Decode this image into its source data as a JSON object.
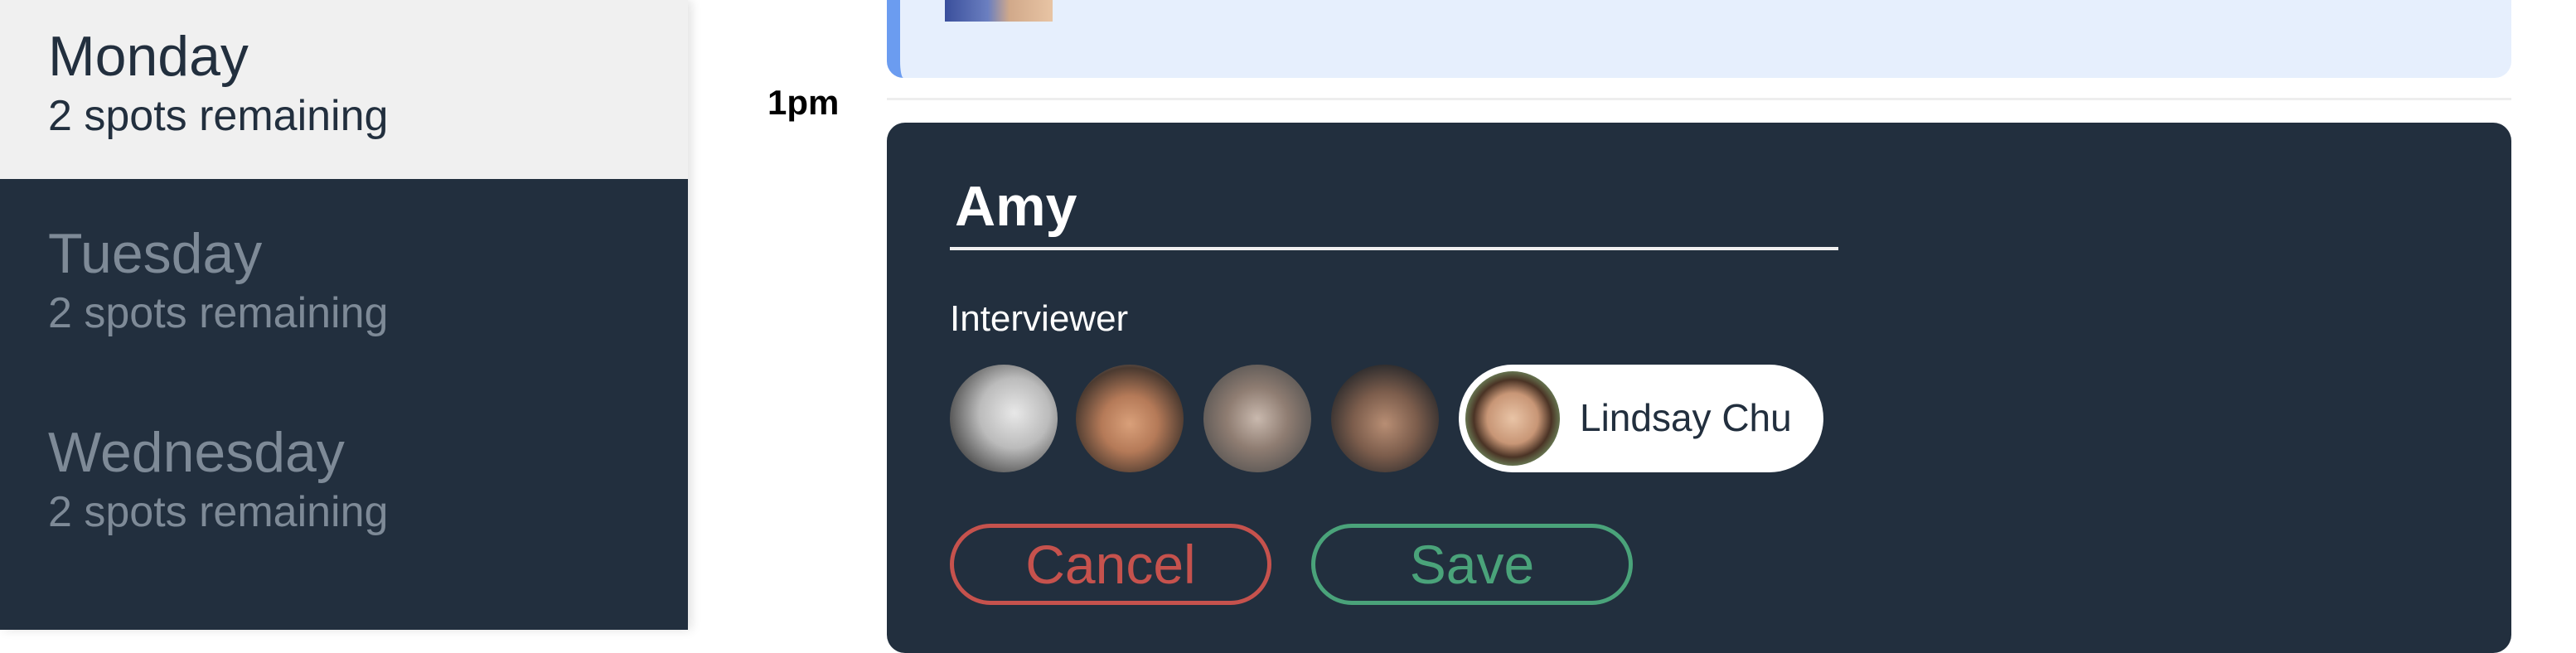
{
  "sidebar": {
    "days": [
      {
        "name": "Monday",
        "spots": "2 spots remaining",
        "selected": true
      },
      {
        "name": "Tuesday",
        "spots": "2 spots remaining",
        "selected": false
      },
      {
        "name": "Wednesday",
        "spots": "2 spots remaining",
        "selected": false
      }
    ]
  },
  "schedule": {
    "time_label": "1pm"
  },
  "editor": {
    "student_name_value": "Amy",
    "interviewer_label": "Interviewer",
    "interviewers": [
      {
        "icon": "interviewer-avatar-1"
      },
      {
        "icon": "interviewer-avatar-2"
      },
      {
        "icon": "interviewer-avatar-3"
      },
      {
        "icon": "interviewer-avatar-4"
      }
    ],
    "selected_interviewer": {
      "name": "Lindsay Chu"
    },
    "cancel_label": "Cancel",
    "save_label": "Save"
  },
  "colors": {
    "sidebar_bg": "#222f3e",
    "selected_day_bg": "#f0f0f0",
    "appointment_bg": "#e6effd",
    "appointment_accent": "#6b9cf0",
    "cancel": "#c6524d",
    "save": "#4aa37a"
  }
}
